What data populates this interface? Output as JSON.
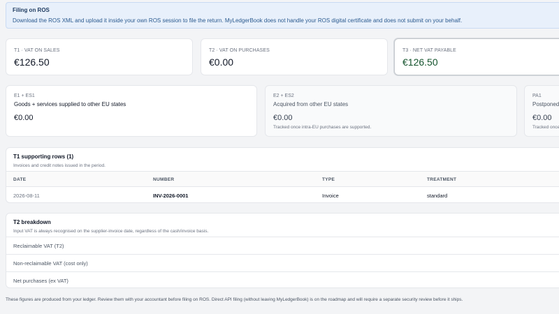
{
  "alert": {
    "title": "Filing on ROS",
    "body": "Download the ROS XML and upload it inside your own ROS session to file the return. MyLedgerBook does not handle your ROS digital certificate and does not submit on your behalf."
  },
  "vat_cards": [
    {
      "label": "T1 · VAT ON SALES",
      "value": "€126.50"
    },
    {
      "label": "T2 · VAT ON PURCHASES",
      "value": "€0.00"
    },
    {
      "label": "T3 · NET VAT PAYABLE",
      "value": "€126.50"
    }
  ],
  "eu_cards": [
    {
      "code": "E1 + ES1",
      "desc": "Goods + services supplied to other EU states",
      "value": "€0.00",
      "note": ""
    },
    {
      "code": "E2 + ES2",
      "desc": "Acquired from other EU states",
      "value": "€0.00",
      "note": "Tracked once intra-EU purchases are supported."
    },
    {
      "code": "PA1",
      "desc": "Postponed-",
      "value": "€0.00",
      "note": "Tracked once"
    }
  ],
  "t1": {
    "title": "T1 supporting rows (1)",
    "subtitle": "Invoices and credit notes issued in the period.",
    "columns": [
      "DATE",
      "NUMBER",
      "TYPE",
      "TREATMENT"
    ],
    "rows": [
      {
        "date": "2026-08-11",
        "number": "INV-2026-0001",
        "type": "Invoice",
        "treatment": "standard"
      }
    ]
  },
  "t2": {
    "title": "T2 breakdown",
    "subtitle": "Input VAT is always recognised on the supplier-invoice date, regardless of the cash/invoice basis.",
    "rows": [
      "Reclaimable VAT (T2)",
      "Non-reclaimable VAT (cost only)",
      "Net purchases (ex VAT)"
    ]
  },
  "footnote": "These figures are produced from your ledger. Review them with your accountant before filing on ROS. Direct API filing (without leaving MyLedgerBook) is on the roadmap and will require a separate security review before it ships."
}
